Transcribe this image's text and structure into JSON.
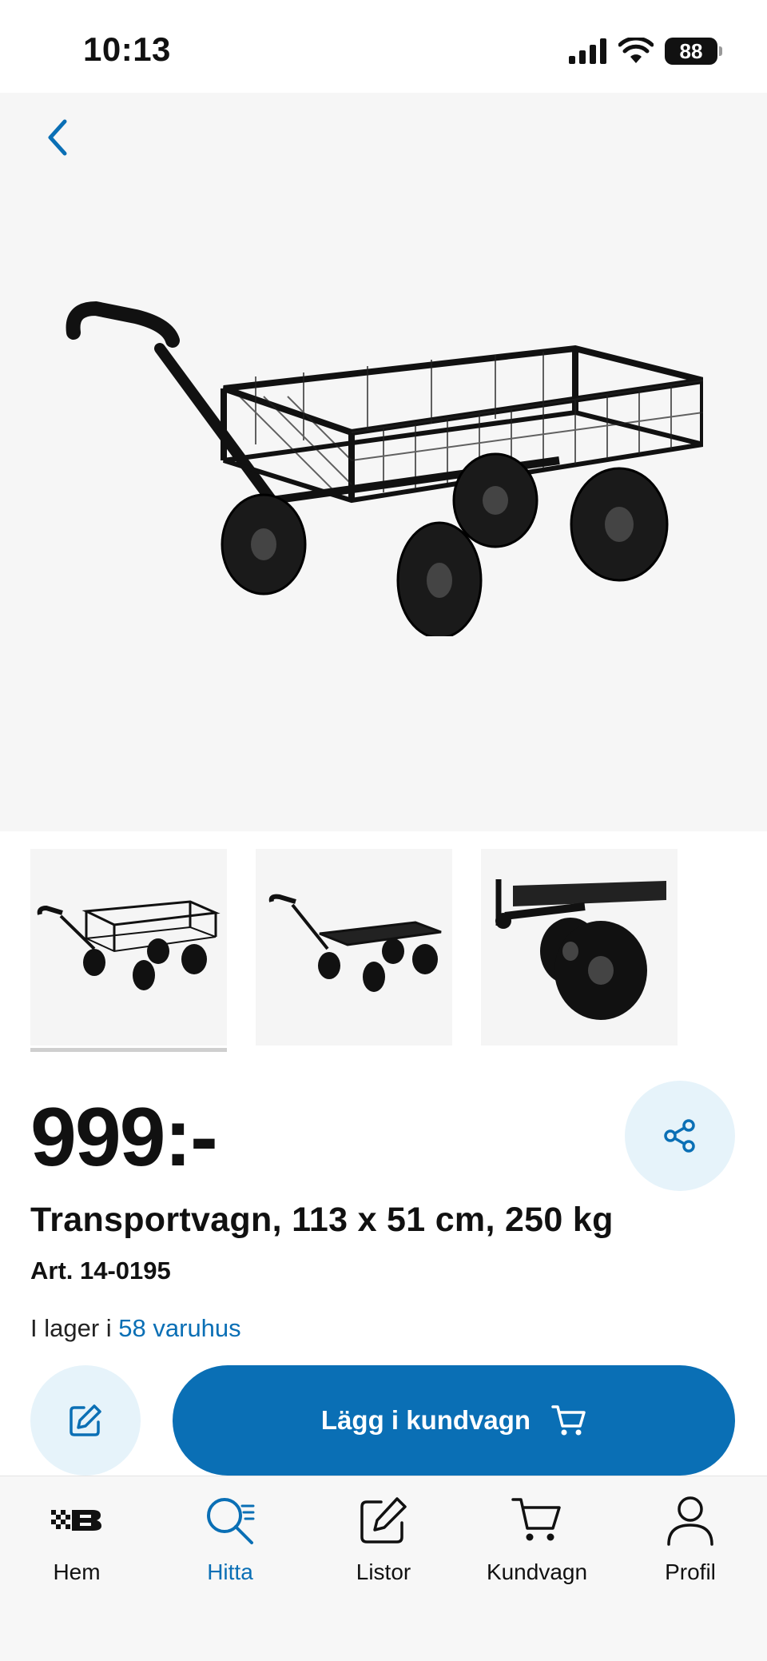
{
  "status_bar": {
    "time": "10:13",
    "battery": "88"
  },
  "product": {
    "price": "999:-",
    "title": "Transportvagn, 113 x 51 cm, 250 kg",
    "article": "Art. 14-0195",
    "stock_prefix": "I lager i ",
    "stock_link": "58 varuhus"
  },
  "thumbnails": {
    "count": 3,
    "active_index": 0
  },
  "actions": {
    "add_to_cart": "Lägg i kundvagn"
  },
  "nav": {
    "items": [
      {
        "label": "Hem",
        "icon": "brand-logo-icon"
      },
      {
        "label": "Hitta",
        "icon": "search-list-icon"
      },
      {
        "label": "Listor",
        "icon": "edit-list-icon"
      },
      {
        "label": "Kundvagn",
        "icon": "cart-icon"
      },
      {
        "label": "Profil",
        "icon": "user-icon"
      }
    ],
    "active_index": 1
  },
  "colors": {
    "accent": "#0a6fb5",
    "accent_light": "#e6f3fa",
    "hero_bg": "#f6f6f6"
  }
}
